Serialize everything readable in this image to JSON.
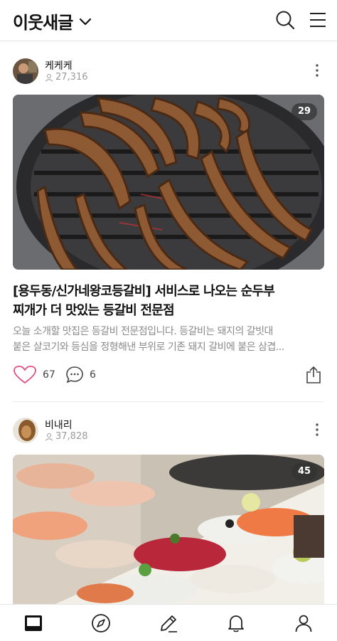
{
  "header": {
    "title": "이웃새글",
    "icons": [
      "chevron-down-icon",
      "search-icon",
      "hamburger-menu-icon"
    ]
  },
  "posts": [
    {
      "author": "케케케",
      "followers": "27,316",
      "image_count": "29",
      "title_line1": "[용두동/신가네왕코등갈비] 서비스로 나오는 순두부",
      "title_line2": "찌개가 더 맛있는 등갈비 전문점",
      "desc_line1": "오늘 소개할 맛집은 등갈비 전문점입니다. 등갈비는 돼지의 갈빗대",
      "desc_line2": "붙은 살코기와 등심을 정형해낸 부위로 기존 돼지 갈비에 붙은 삼겹...",
      "likes": "67",
      "comments": "6"
    },
    {
      "author": "비내리",
      "followers": "37,828",
      "image_count": "45"
    }
  ],
  "tabbar": {
    "items": [
      "home-feed-icon",
      "compass-icon",
      "pencil-icon",
      "bell-icon",
      "profile-icon"
    ]
  },
  "colors": {
    "heart": "#e0507f",
    "text": "#111111",
    "muted": "#8a8a8a"
  }
}
